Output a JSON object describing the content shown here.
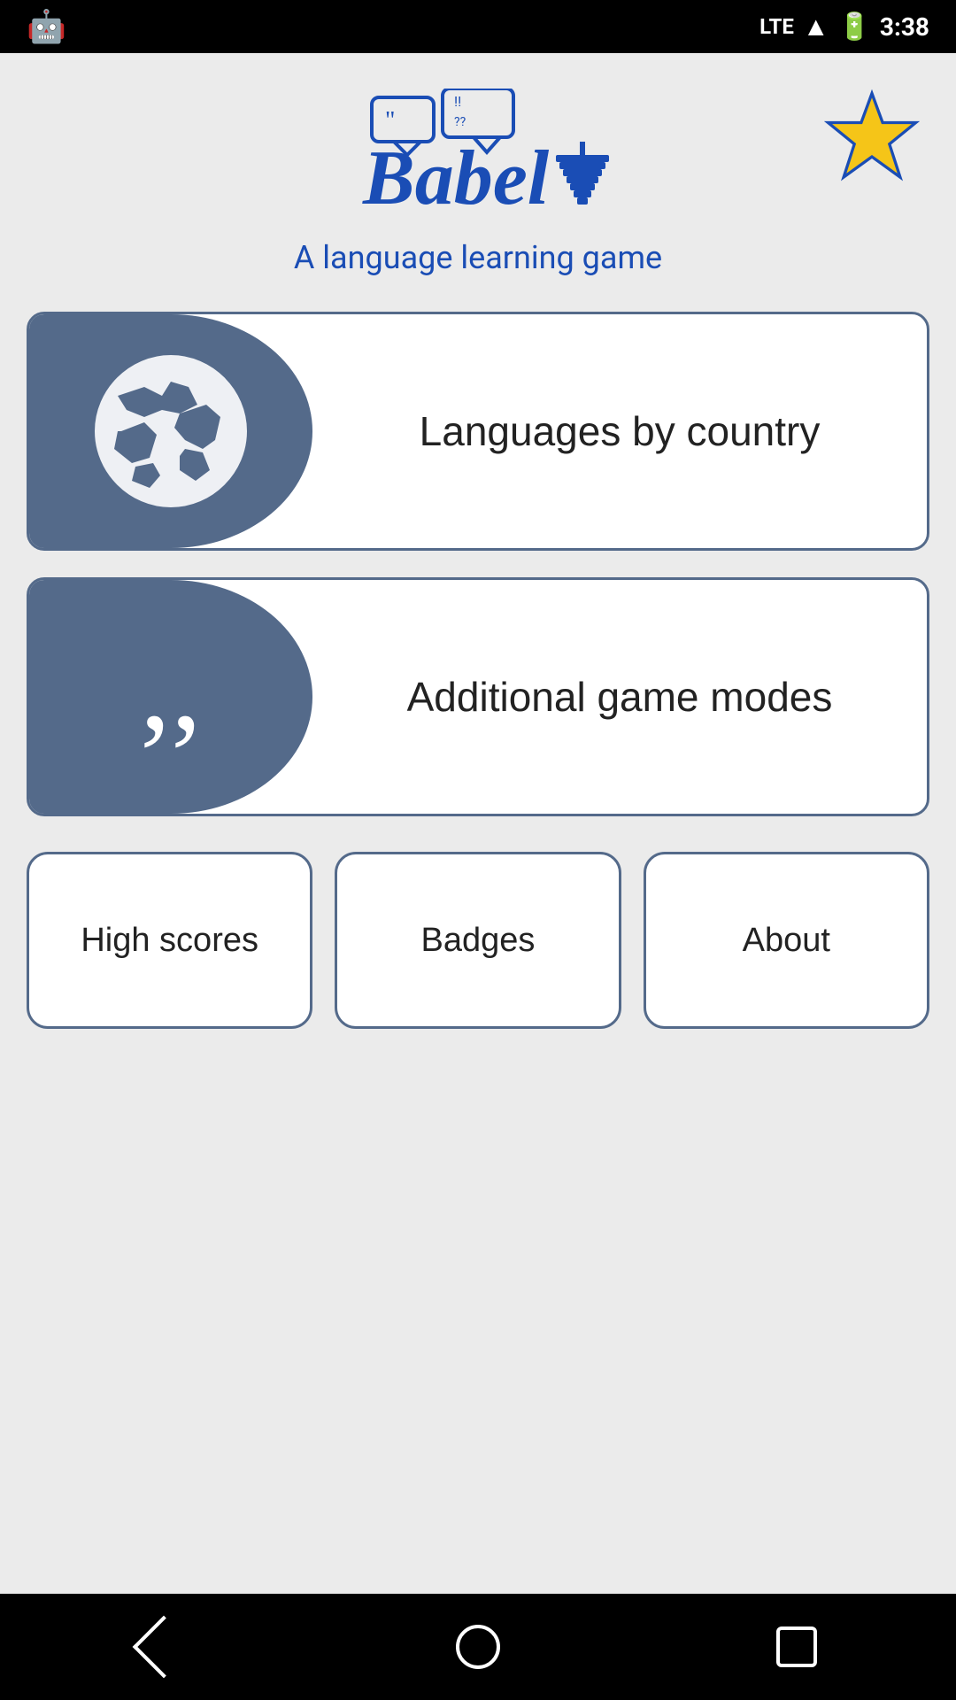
{
  "statusBar": {
    "time": "3:38",
    "signal": "LTE",
    "battery": "⚡"
  },
  "header": {
    "appName": "Babel",
    "subtitle": "A language learning game",
    "starLabel": "★"
  },
  "mainButtons": [
    {
      "id": "languages-by-country",
      "label": "Languages by\ncountry",
      "icon": "globe-icon"
    },
    {
      "id": "additional-game-modes",
      "label": "Additional game modes",
      "icon": "quote-icon"
    }
  ],
  "bottomButtons": [
    {
      "id": "high-scores",
      "label": "High scores"
    },
    {
      "id": "badges",
      "label": "Badges"
    },
    {
      "id": "about",
      "label": "About"
    }
  ],
  "colors": {
    "accent": "#546a8a",
    "blue": "#1a4db5",
    "starYellow": "#f5c518"
  }
}
